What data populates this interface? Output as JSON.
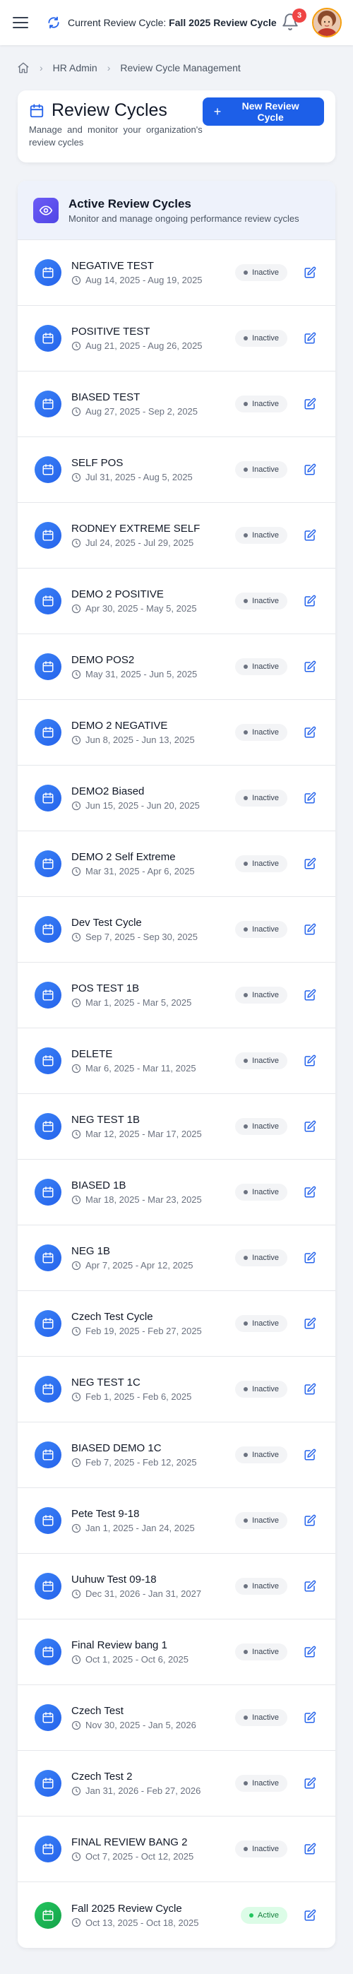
{
  "topbar": {
    "cycle_prefix": "Current Review Cycle: ",
    "cycle_name": "Fall 2025 Review Cycle",
    "notification_count": "3"
  },
  "breadcrumb": {
    "items": [
      "HR Admin",
      "Review Cycle Management"
    ]
  },
  "header": {
    "title": "Review Cycles",
    "subtitle": "Manage and monitor your organization's review cycles",
    "new_button_label": "New Review Cycle"
  },
  "list": {
    "title": "Active Review Cycles",
    "subtitle": "Monitor and manage ongoing performance review cycles",
    "rows": [
      {
        "name": "NEGATIVE TEST",
        "dates": "Aug 14, 2025 - Aug 19, 2025",
        "status": "Inactive"
      },
      {
        "name": "POSITIVE TEST",
        "dates": "Aug 21, 2025 - Aug 26, 2025",
        "status": "Inactive"
      },
      {
        "name": "BIASED TEST",
        "dates": "Aug 27, 2025 - Sep 2, 2025",
        "status": "Inactive"
      },
      {
        "name": "SELF POS",
        "dates": "Jul 31, 2025 - Aug 5, 2025",
        "status": "Inactive"
      },
      {
        "name": "RODNEY EXTREME SELF",
        "dates": "Jul 24, 2025 - Jul 29, 2025",
        "status": "Inactive"
      },
      {
        "name": "DEMO 2 POSITIVE",
        "dates": "Apr 30, 2025 - May 5, 2025",
        "status": "Inactive"
      },
      {
        "name": "DEMO POS2",
        "dates": "May 31, 2025 - Jun 5, 2025",
        "status": "Inactive"
      },
      {
        "name": "DEMO 2 NEGATIVE",
        "dates": "Jun 8, 2025 - Jun 13, 2025",
        "status": "Inactive"
      },
      {
        "name": "DEMO2 Biased",
        "dates": "Jun 15, 2025 - Jun 20, 2025",
        "status": "Inactive"
      },
      {
        "name": "DEMO 2 Self Extreme",
        "dates": "Mar 31, 2025 - Apr 6, 2025",
        "status": "Inactive"
      },
      {
        "name": "Dev Test Cycle",
        "dates": "Sep 7, 2025 - Sep 30, 2025",
        "status": "Inactive"
      },
      {
        "name": "POS TEST 1B",
        "dates": "Mar 1, 2025 - Mar 5, 2025",
        "status": "Inactive"
      },
      {
        "name": "DELETE",
        "dates": "Mar 6, 2025 - Mar 11, 2025",
        "status": "Inactive"
      },
      {
        "name": "NEG TEST 1B",
        "dates": "Mar 12, 2025 - Mar 17, 2025",
        "status": "Inactive"
      },
      {
        "name": "BIASED 1B",
        "dates": "Mar 18, 2025 - Mar 23, 2025",
        "status": "Inactive"
      },
      {
        "name": "NEG 1B",
        "dates": "Apr 7, 2025 - Apr 12, 2025",
        "status": "Inactive"
      },
      {
        "name": "Czech Test Cycle",
        "dates": "Feb 19, 2025 - Feb 27, 2025",
        "status": "Inactive"
      },
      {
        "name": "NEG TEST 1C",
        "dates": "Feb 1, 2025 - Feb 6, 2025",
        "status": "Inactive"
      },
      {
        "name": "BIASED DEMO 1C",
        "dates": "Feb 7, 2025 - Feb 12, 2025",
        "status": "Inactive"
      },
      {
        "name": "Pete Test 9-18",
        "dates": "Jan 1, 2025 - Jan 24, 2025",
        "status": "Inactive"
      },
      {
        "name": "Uuhuw Test 09-18",
        "dates": "Dec 31, 2026 - Jan 31, 2027",
        "status": "Inactive"
      },
      {
        "name": "Final Review bang 1",
        "dates": "Oct 1, 2025 - Oct 6, 2025",
        "status": "Inactive"
      },
      {
        "name": "Czech Test",
        "dates": "Nov 30, 2025 - Jan 5, 2026",
        "status": "Inactive"
      },
      {
        "name": "Czech Test 2",
        "dates": "Jan 31, 2026 - Feb 27, 2026",
        "status": "Inactive"
      },
      {
        "name": "FINAL REVIEW BANG 2",
        "dates": "Oct 7, 2025 - Oct 12, 2025",
        "status": "Inactive"
      },
      {
        "name": "Fall 2025 Review Cycle",
        "dates": "Oct 13, 2025 - Oct 18, 2025",
        "status": "Active"
      }
    ]
  },
  "colors": {
    "primary": "#1d5fe8",
    "row_icon_blue": "#2563eb",
    "row_icon_green": "#16a34a",
    "active_badge_bg": "#dcfce7",
    "inactive_badge_bg": "#f3f4f6",
    "notification_badge": "#ef4444"
  }
}
